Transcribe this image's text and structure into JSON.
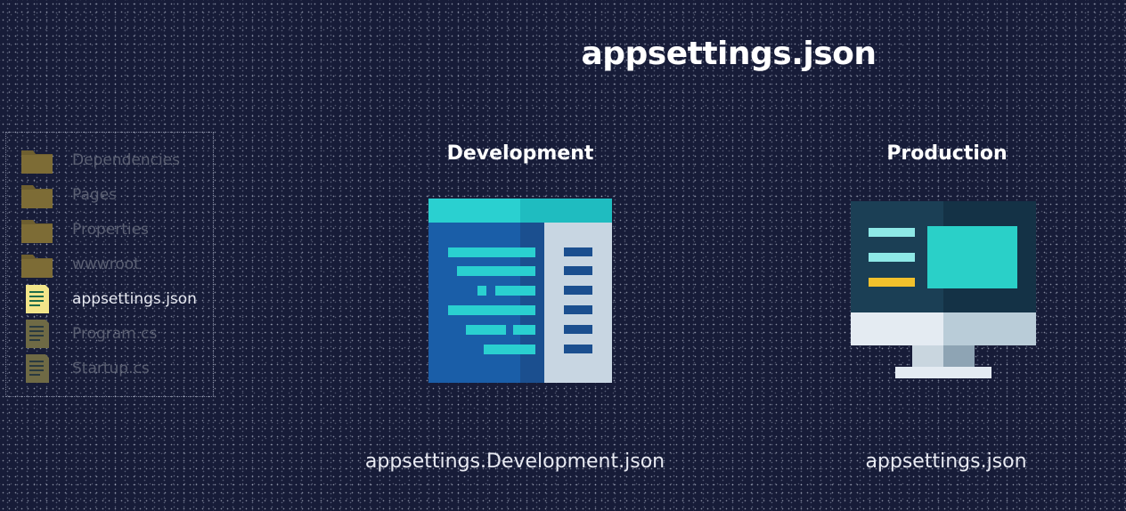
{
  "title": "appsettings.json",
  "tree": {
    "items": [
      {
        "label": "Dependencies",
        "icon": "folder-icon"
      },
      {
        "label": "Pages",
        "icon": "folder-icon"
      },
      {
        "label": "Properties",
        "icon": "folder-icon"
      },
      {
        "label": "wwwroot",
        "icon": "folder-icon"
      },
      {
        "label": "appsettings.json",
        "icon": "file-icon",
        "active": true
      },
      {
        "label": "Program.cs",
        "icon": "file-icon"
      },
      {
        "label": "Startup.cs",
        "icon": "file-icon"
      }
    ]
  },
  "development": {
    "heading": "Development",
    "caption": "appsettings.Development.json",
    "icon": "code-editor-icon"
  },
  "production": {
    "heading": "Production",
    "caption": "appsettings.json",
    "icon": "monitor-icon"
  },
  "colors": {
    "background": "#171c38",
    "folder": "#7a6a35",
    "file_active": "#f2e58a",
    "teal": "#25c8c8",
    "blue": "#1a5ea8"
  }
}
